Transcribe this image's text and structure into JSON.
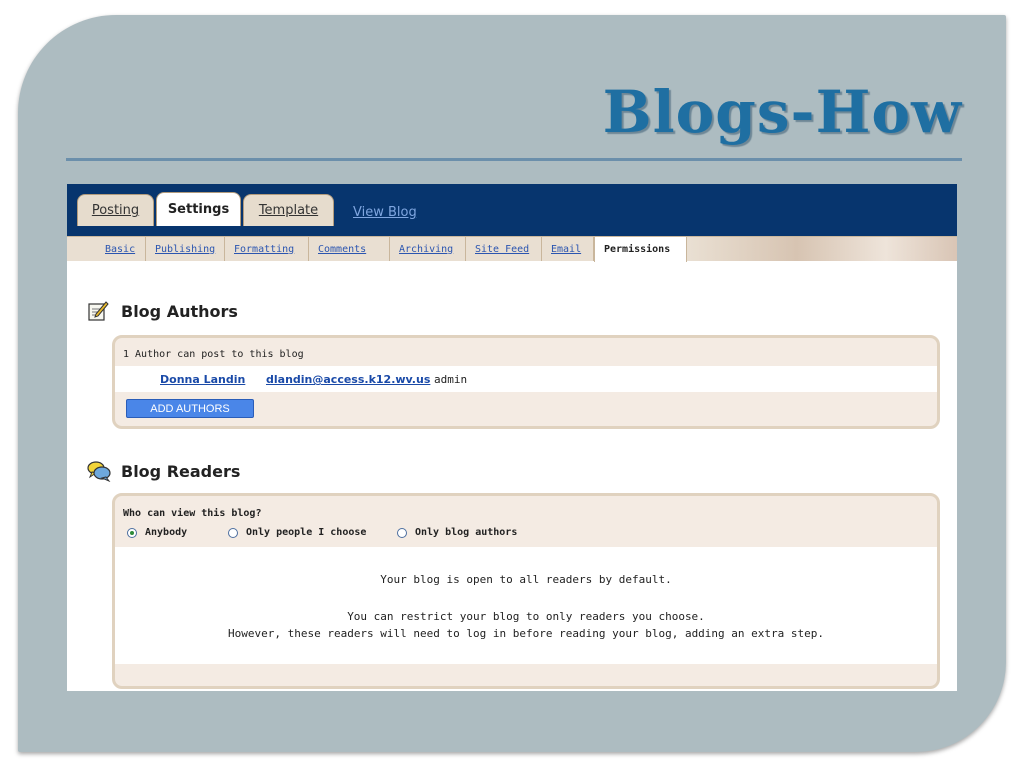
{
  "slide": {
    "title": "Blogs-How"
  },
  "tabs": [
    {
      "label": "Posting",
      "active": false
    },
    {
      "label": "Settings",
      "active": true
    },
    {
      "label": "Template",
      "active": false
    }
  ],
  "view_blog": "View Blog",
  "subtabs": [
    {
      "label": "Basic"
    },
    {
      "label": "Publishing"
    },
    {
      "label": "Formatting"
    },
    {
      "label": "Comments"
    },
    {
      "label": "Archiving"
    },
    {
      "label": "Site Feed"
    },
    {
      "label": "Email"
    },
    {
      "label": "Permissions",
      "active": true
    }
  ],
  "authors": {
    "heading": "Blog Authors",
    "count_text": "1 Author can post to this blog",
    "list": [
      {
        "name": "Donna Landin",
        "email": "dlandin@access.k12.wv.us",
        "role": "admin"
      }
    ],
    "add_button": "ADD AUTHORS"
  },
  "readers": {
    "heading": "Blog Readers",
    "question": "Who can view this blog?",
    "options": [
      {
        "label": "Anybody",
        "checked": true
      },
      {
        "label": "Only people I choose",
        "checked": false
      },
      {
        "label": "Only blog authors",
        "checked": false
      }
    ],
    "message_1": "Your blog is open to all readers by default.",
    "message_2": "You can restrict your blog to only readers you choose.",
    "message_3": "However, these readers will need to log in before reading your blog, adding an extra step."
  },
  "colors": {
    "slide_bg": "#adbcc1",
    "title": "#1f6fa2",
    "topbar": "#07356e",
    "link": "#1a4aa8",
    "button": "#4a86e8"
  }
}
